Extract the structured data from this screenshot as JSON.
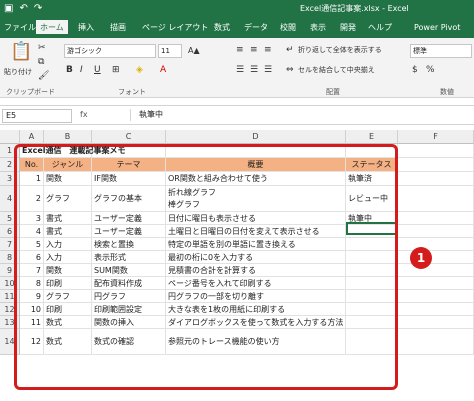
{
  "window": {
    "title": "Excel通信記事案.xlsx - Excel",
    "qat": {
      "save_icon": "floppy",
      "undo_icon": "↶",
      "redo_icon": "↷"
    }
  },
  "tabs": [
    "ファイル",
    "ホーム",
    "挿入",
    "描画",
    "ページ レイアウト",
    "数式",
    "データ",
    "校閲",
    "表示",
    "開発",
    "ヘルプ",
    "Power Pivot"
  ],
  "active_tab": "ホーム",
  "ribbon": {
    "paste_label": "貼り付け",
    "clipboard_label": "クリップボード",
    "font_name": "游ゴシック",
    "font_size": "11",
    "font_label": "フォント",
    "wrap_text_label": "折り返して全体を表示する",
    "merge_label": "セルを結合して中央揃え",
    "alignment_label": "配置",
    "number_format": "標準",
    "number_label": "数値",
    "bold": "B",
    "italic": "I",
    "underline": "U"
  },
  "formula_bar": {
    "name_box": "E5",
    "fx": "fx",
    "value": "執筆中"
  },
  "columns": [
    "A",
    "B",
    "C",
    "D",
    "E",
    "F"
  ],
  "sheet": {
    "title": "Excel通信　連載記事案メモ",
    "headers": [
      "No.",
      "ジャンル",
      "テーマ",
      "概要",
      "ステータス"
    ],
    "rows": [
      {
        "no": "1",
        "genre": "関数",
        "theme": "IF関数",
        "summary": "OR関数と組み合わせて使う",
        "status": "執筆済"
      },
      {
        "no": "2",
        "genre": "グラフ",
        "theme": "グラフの基本",
        "summary": "折れ線グラフ\n棒グラフ",
        "status": "レビュー中"
      },
      {
        "no": "3",
        "genre": "書式",
        "theme": "ユーザー定義",
        "summary": "日付に曜日も表示させる",
        "status": "執筆中"
      },
      {
        "no": "4",
        "genre": "書式",
        "theme": "ユーザー定義",
        "summary": "土曜日と日曜日の日付を変えて表示させる",
        "status": ""
      },
      {
        "no": "5",
        "genre": "入力",
        "theme": "検索と置換",
        "summary": "特定の単語を別の単語に置き換える",
        "status": ""
      },
      {
        "no": "6",
        "genre": "入力",
        "theme": "表示形式",
        "summary": "最初の桁に0を入力する",
        "status": ""
      },
      {
        "no": "7",
        "genre": "関数",
        "theme": "SUM関数",
        "summary": "見積書の合計を計算する",
        "status": ""
      },
      {
        "no": "8",
        "genre": "印刷",
        "theme": "配布資料作成",
        "summary": "ページ番号を入れて印刷する",
        "status": ""
      },
      {
        "no": "9",
        "genre": "グラフ",
        "theme": "円グラフ",
        "summary": "円グラフの一部を切り離す",
        "status": ""
      },
      {
        "no": "10",
        "genre": "印刷",
        "theme": "印刷範囲設定",
        "summary": "大きな表を1枚の用紙に印刷する",
        "status": ""
      },
      {
        "no": "11",
        "genre": "数式",
        "theme": "関数の挿入",
        "summary": "ダイアログボックスを使って数式を入力する方法",
        "status": ""
      },
      {
        "no": "12",
        "genre": "数式",
        "theme": "数式の確認",
        "summary": "参照元のトレース機能の使い方",
        "status": ""
      }
    ],
    "row_numbers": [
      "1",
      "2",
      "3",
      "4",
      "5",
      "6",
      "7",
      "8",
      "9",
      "10",
      "11",
      "12",
      "13",
      "14"
    ]
  },
  "annotation": {
    "badge": "1"
  },
  "colors": {
    "accent": "#217346",
    "header_fill": "#f4b183",
    "highlight": "#d41c1c"
  }
}
